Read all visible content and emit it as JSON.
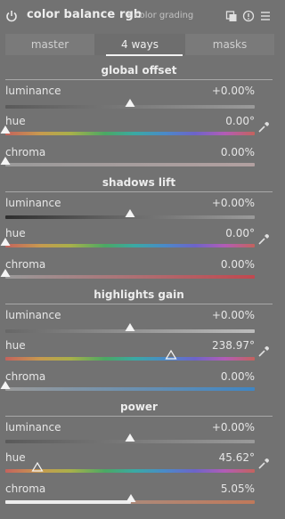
{
  "header": {
    "title": "color balance rgb",
    "subtitle": "• color grading",
    "icons": [
      "power-icon",
      "presets-icon",
      "reset-icon",
      "menu-icon"
    ]
  },
  "tabs": [
    {
      "label": "master",
      "active": false
    },
    {
      "label": "4 ways",
      "active": true
    },
    {
      "label": "masks",
      "active": false
    }
  ],
  "sections": [
    {
      "title": "global offset",
      "luminance": {
        "label": "luminance",
        "value": "+0.00%",
        "level": 0.5
      },
      "hue": {
        "label": "hue",
        "value": "0.00°",
        "level": 0.0
      },
      "chroma": {
        "label": "chroma",
        "value": "0.00%",
        "level": 0.0
      }
    },
    {
      "title": "shadows lift",
      "luminance": {
        "label": "luminance",
        "value": "+0.00%",
        "level": 0.5
      },
      "hue": {
        "label": "hue",
        "value": "0.00°",
        "level": 0.0
      },
      "chroma": {
        "label": "chroma",
        "value": "0.00%",
        "level": 0.0
      }
    },
    {
      "title": "highlights gain",
      "luminance": {
        "label": "luminance",
        "value": "+0.00%",
        "level": 0.5
      },
      "hue": {
        "label": "hue",
        "value": "238.97°",
        "level": 0.664
      },
      "chroma": {
        "label": "chroma",
        "value": "0.00%",
        "level": 0.0
      }
    },
    {
      "title": "power",
      "luminance": {
        "label": "luminance",
        "value": "+0.00%",
        "level": 0.5
      },
      "hue": {
        "label": "hue",
        "value": "45.62°",
        "level": 0.127
      },
      "chroma": {
        "label": "chroma",
        "value": "5.05%",
        "level": 0.505
      }
    }
  ],
  "colors": {
    "background": "#727272",
    "text": "#e4e4e4",
    "active_tab_underline": "#f2f2f2"
  }
}
